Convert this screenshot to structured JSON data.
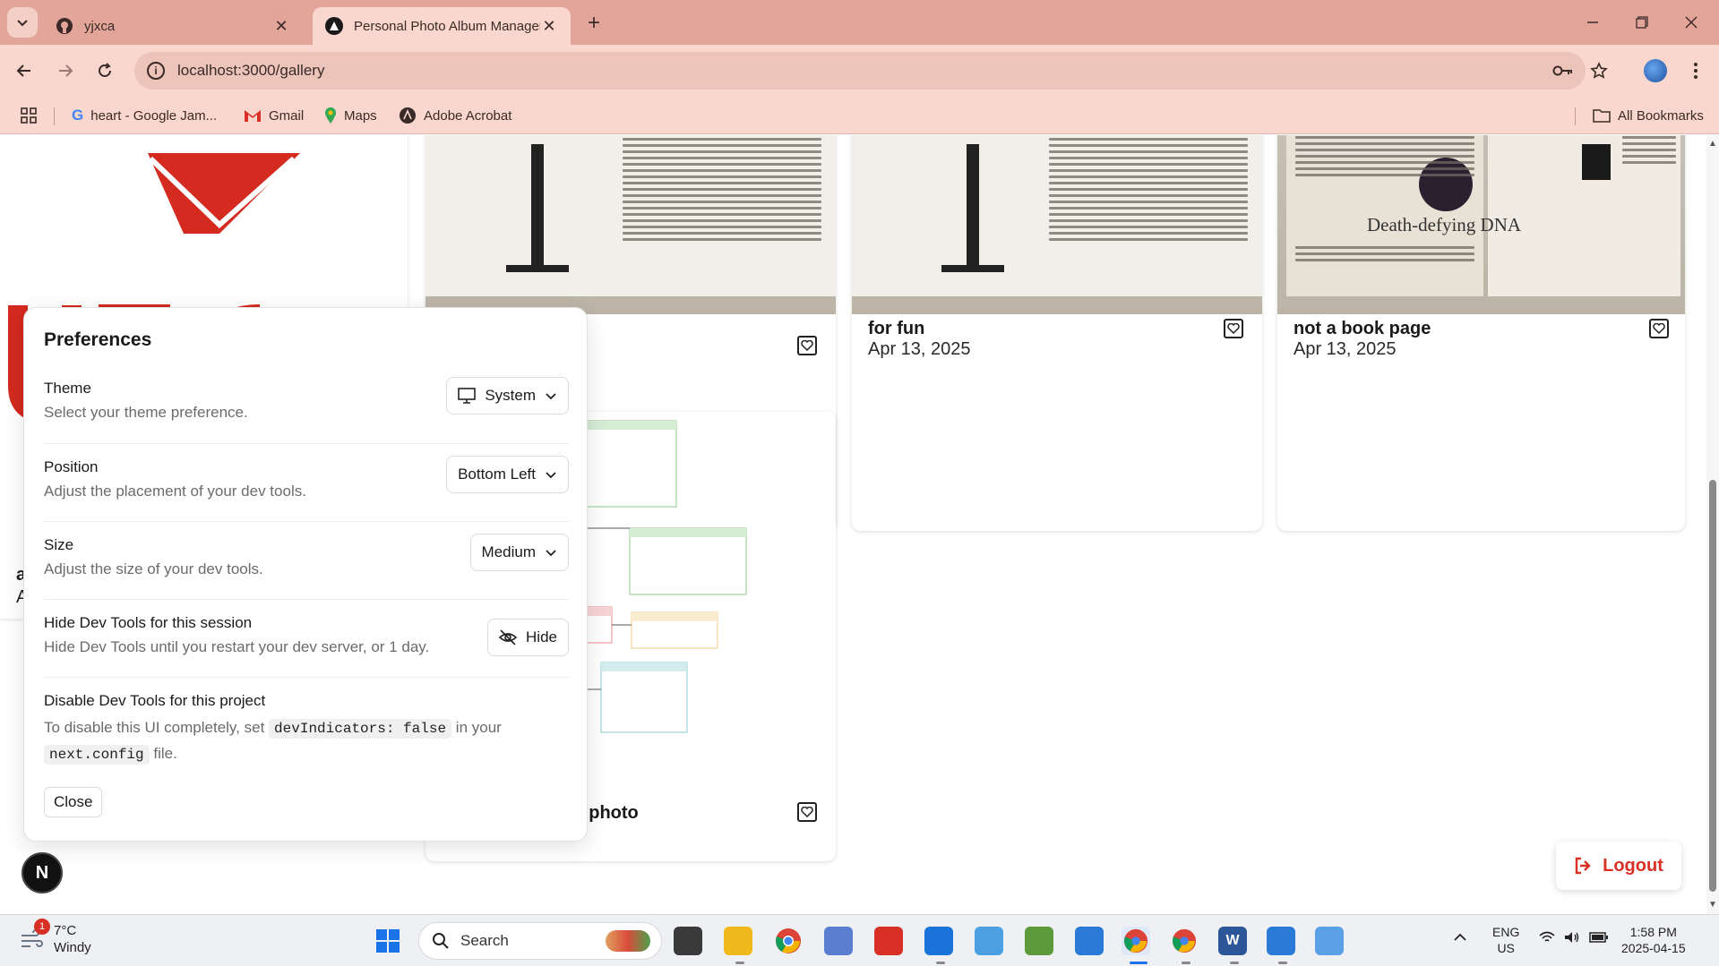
{
  "browser": {
    "tabs": [
      {
        "title": "yjxca",
        "active": false,
        "icon": "github-icon"
      },
      {
        "title": "Personal Photo Album Manager",
        "active": true,
        "icon": "nextjs-icon"
      }
    ],
    "url": "localhost:3000/gallery",
    "bookmarks": [
      {
        "label": "heart - Google Jam...",
        "icon": "google-icon"
      },
      {
        "label": "Gmail",
        "icon": "gmail-icon"
      },
      {
        "label": "Maps",
        "icon": "maps-icon"
      },
      {
        "label": "Adobe Acrobat",
        "icon": "acrobat-icon"
      }
    ],
    "all_bookmarks_label": "All Bookmarks"
  },
  "gallery": {
    "cards": [
      {
        "title": "",
        "date": "",
        "favorited": false
      },
      {
        "title": "for fun",
        "date": "Apr 13, 2025",
        "favorited": false
      },
      {
        "title": "not a book page",
        "date": "Apr 13, 2025",
        "favorited": false
      },
      {
        "title": "ram photo",
        "date": "",
        "favorited": false
      }
    ],
    "book_cover_text": "Death-defying DNA",
    "logout_label": "Logout"
  },
  "preferences": {
    "title": "Preferences",
    "theme": {
      "label": "Theme",
      "desc": "Select your theme preference.",
      "value": "System"
    },
    "position": {
      "label": "Position",
      "desc": "Adjust the placement of your dev tools.",
      "value": "Bottom Left"
    },
    "size": {
      "label": "Size",
      "desc": "Adjust the size of your dev tools.",
      "value": "Medium"
    },
    "hide": {
      "label": "Hide Dev Tools for this session",
      "desc": "Hide Dev Tools until you restart your dev server, or 1 day.",
      "button": "Hide"
    },
    "disable": {
      "label": "Disable Dev Tools for this project",
      "desc_pre": "To disable this UI completely, set",
      "code1": "devIndicators: false",
      "desc_mid": "in your",
      "code2": "next.config",
      "desc_post": "file."
    },
    "close_label": "Close",
    "badge_letter": "N"
  },
  "taskbar": {
    "weather": {
      "temp": "7°C",
      "condition": "Windy",
      "badge": "1"
    },
    "search_placeholder": "Search",
    "lang_top": "ENG",
    "lang_bottom": "US",
    "time": "1:58 PM",
    "date": "2025-04-15"
  },
  "colors": {
    "tabstrip": "#e3a59a",
    "toolbar": "#f9d6ce",
    "brand_red": "#d93025",
    "logout": "#d93025"
  }
}
